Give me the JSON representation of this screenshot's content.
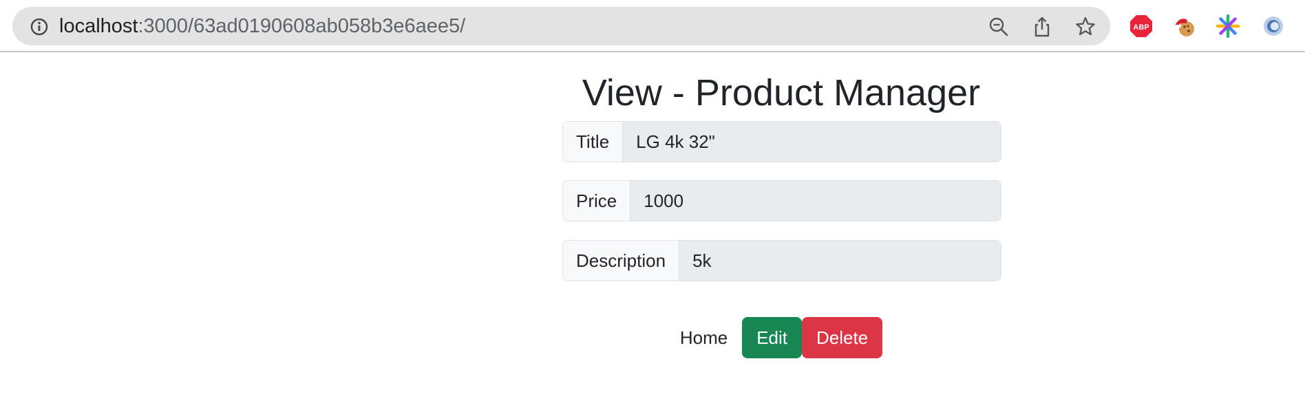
{
  "browser": {
    "url_host": "localhost",
    "url_path": ":3000/63ad0190608ab058b3e6aee5/",
    "extensions": [
      "adblock-plus-icon",
      "cookie-extension-icon",
      "asterisk-extension-icon",
      "ring-extension-icon"
    ],
    "abp_label": "ABP"
  },
  "page": {
    "title": "View - Product Manager"
  },
  "fields": [
    {
      "label": "Title",
      "value": "LG 4k 32\""
    },
    {
      "label": "Price",
      "value": "1000"
    },
    {
      "label": "Description",
      "value": "5k"
    }
  ],
  "actions": {
    "home_label": "Home",
    "edit_label": "Edit",
    "delete_label": "Delete"
  },
  "colors": {
    "edit_button": "#198754",
    "delete_button": "#dc3545",
    "field_value_bg": "#e9ecef",
    "field_label_bg": "#f8f9fa"
  }
}
